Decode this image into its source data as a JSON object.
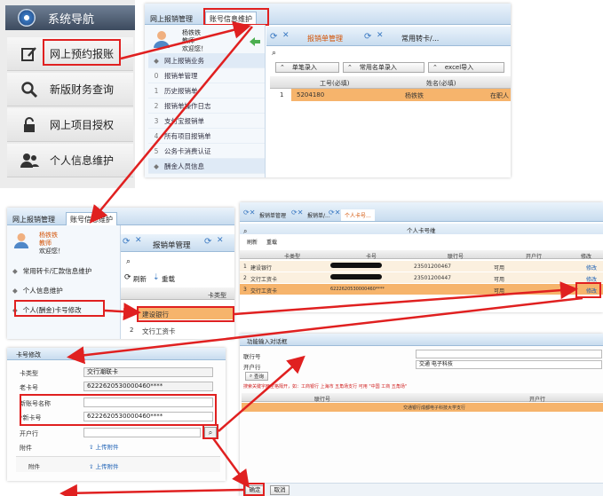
{
  "panel1": {
    "title": "系统导航",
    "items": [
      {
        "label": "网上预约报账",
        "icon": "edit-icon"
      },
      {
        "label": "新版财务查询",
        "icon": "search-icon"
      },
      {
        "label": "网上项目授权",
        "icon": "lock-icon"
      },
      {
        "label": "个人信息维护",
        "icon": "users-icon"
      }
    ]
  },
  "panel2": {
    "tab1": "网上报销管理",
    "tab2": "账号信息维护",
    "user_name": "杨铁铁",
    "user_role": "教师",
    "welcome": "欢迎您！",
    "menu": [
      {
        "num": "",
        "label": "网上报销业务"
      },
      {
        "num": "0",
        "label": "报销单管理"
      },
      {
        "num": "1",
        "label": "历史报销单"
      },
      {
        "num": "2",
        "label": "报销单操作日志"
      },
      {
        "num": "3",
        "label": "支付宝报销单"
      },
      {
        "num": "4",
        "label": "所有项目报销单"
      },
      {
        "num": "5",
        "label": "公务卡消费认证"
      },
      {
        "num": "",
        "label": "酬金人员信息"
      }
    ],
    "content_tab1": "报销单管理",
    "content_tab2": "常用转卡/...",
    "btn1": "单笔录入",
    "btn2": "常用名单录入",
    "btn3": "excel导入",
    "col1": "工号(必填)",
    "col2": "姓名(必填)",
    "row_num": "1",
    "row_id": "5204180",
    "row_name": "杨铁铁",
    "row_extra": "在职人"
  },
  "panel3": {
    "tab1": "网上报销管理",
    "tab2": "账号信息维护",
    "user_name": "杨铁铁",
    "user_role": "教师",
    "welcome": "欢迎您！",
    "menu": [
      {
        "label": "常用转卡/汇款信息维护"
      },
      {
        "label": "个人信息维护"
      },
      {
        "label": "个人(酬金)卡号修改"
      }
    ],
    "content_tab": "报销单管理",
    "refresh": "刷新",
    "reload": "重载",
    "col_header": "卡类型",
    "rows": [
      {
        "num": "1",
        "label": "建设银行"
      },
      {
        "num": "2",
        "label": "文行工资卡"
      }
    ]
  },
  "panel4": {
    "tab1": "报销单管理",
    "tab2": "报销单/...",
    "tab3": "个人卡号...",
    "title": "个人卡号维",
    "refresh": "刷新",
    "reload": "重载",
    "headers": [
      "卡类型",
      "卡号",
      "联行号",
      "开户行",
      "修改"
    ],
    "rows": [
      {
        "num": "1",
        "type": "建设银行",
        "lian": "23501200467",
        "bank": "可用",
        "edit": "修改"
      },
      {
        "num": "2",
        "type": "文行工资卡",
        "lian": "23501200447",
        "bank": "可用",
        "edit": "修改"
      },
      {
        "num": "3",
        "type": "交行工资卡",
        "card": "6222620530000460****",
        "bank": "可用",
        "edit": "修改"
      }
    ]
  },
  "panel5": {
    "title": "卡号修改",
    "fields": [
      {
        "label": "卡类型",
        "value": "交行潮联卡"
      },
      {
        "label": "老卡号",
        "value": "6222620530000460****"
      },
      {
        "label": "新账号名称",
        "value": ""
      },
      {
        "label": "*新卡号",
        "value": "6222620530000460****"
      },
      {
        "label": "开户行",
        "value": ""
      },
      {
        "label": "附件",
        "value": "上传附件"
      }
    ],
    "attach_label": "附件",
    "attach_btn": "上传附件"
  },
  "panel6": {
    "title": "功能输入对话框",
    "field1_label": "联行号",
    "field2_label": "开户行",
    "field2_value": "交通 电子科技",
    "search_btn": "查询",
    "hint": "搜索关键字两空格隔开，如：工商银行 上海市 五角场支行 可用 \"中国 工商 五角场\"",
    "col1": "联行号",
    "col2": "开户行",
    "result": "交通银行成都电子科技大学支行",
    "ok": "确定",
    "cancel": "取消"
  },
  "colors": {
    "arrow": "#e02020",
    "highlight": "#f6b46c",
    "accent_blue": "#3a79c2"
  }
}
